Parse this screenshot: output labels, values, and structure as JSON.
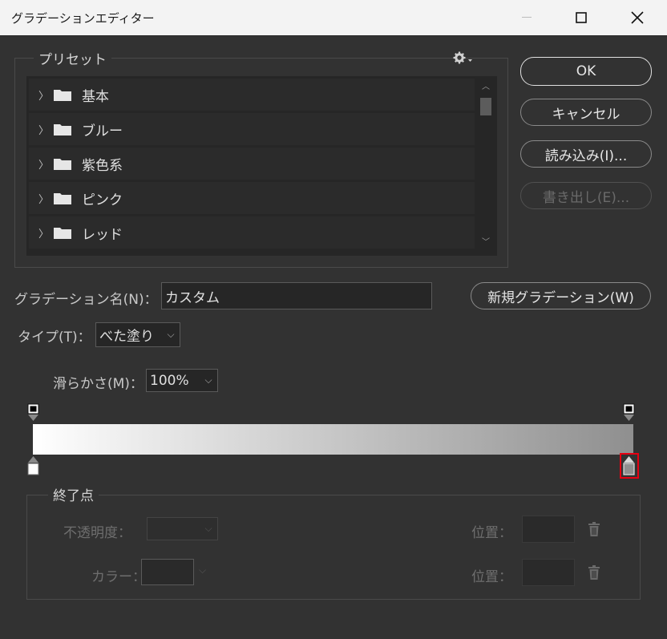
{
  "window": {
    "title": "グラデーションエディター"
  },
  "preset": {
    "legend": "プリセット",
    "items": [
      {
        "label": "基本"
      },
      {
        "label": "ブルー"
      },
      {
        "label": "紫色系"
      },
      {
        "label": "ピンク"
      },
      {
        "label": "レッド"
      }
    ]
  },
  "buttons": {
    "ok": "OK",
    "cancel": "キャンセル",
    "load": "読み込み(I)...",
    "export": "書き出し(E)...",
    "new_gradient": "新規グラデーション(W)"
  },
  "gradient_name": {
    "label": "グラデーション名(N)：",
    "value": "カスタム"
  },
  "type": {
    "label": "タイプ(T)：",
    "value": "べた塗り"
  },
  "smoothness": {
    "label": "滑らかさ(M)：",
    "value": "100%"
  },
  "gradient": {
    "start_color": "#ffffff",
    "end_color": "#8f8f8f",
    "highlight_color": "#e60012"
  },
  "end_point": {
    "legend": "終了点",
    "opacity_label": "不透明度：",
    "color_label": "カラー：",
    "position_label_1": "位置：",
    "position_label_2": "位置："
  }
}
